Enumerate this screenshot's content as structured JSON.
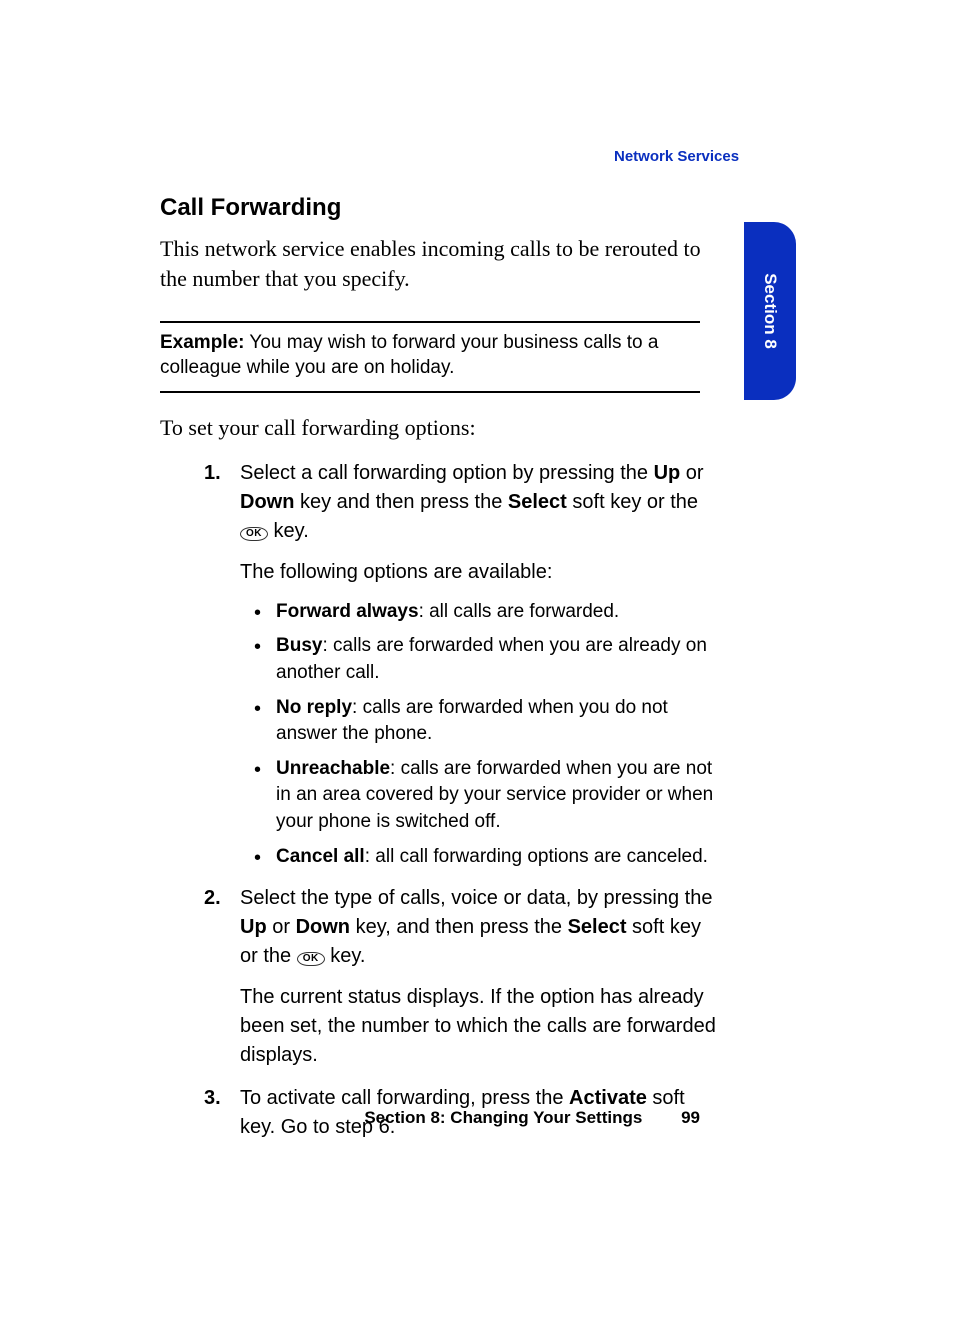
{
  "header": {
    "category": "Network Services"
  },
  "tab": {
    "label": "Section 8"
  },
  "title": "Call Forwarding",
  "intro": "This network service enables incoming calls to be rerouted to the number that you specify.",
  "example": {
    "label": "Example:",
    "text": "You may wish to forward your business calls to a colleague while you are on holiday."
  },
  "lead": "To set your call forwarding options:",
  "ok_label": "OK",
  "step1": {
    "t1": "Select a call forwarding option by pressing the ",
    "up": "Up",
    "t2": " or ",
    "down": "Down",
    "t3": " key and then press the ",
    "select": "Select",
    "t4": " soft key or the ",
    "t5": " key.",
    "avail": "The following options are available:"
  },
  "options": {
    "fa": {
      "name": "Forward always",
      "desc": ": all calls are forwarded."
    },
    "busy": {
      "name": "Busy",
      "desc": ": calls are forwarded when you are already on another call."
    },
    "nr": {
      "name": "No reply",
      "desc": ": calls are forwarded when you do not answer the phone."
    },
    "un": {
      "name": "Unreachable",
      "desc": ": calls are forwarded when you are not in an area covered by your service provider or when your phone is switched off."
    },
    "ca": {
      "name": "Cancel all",
      "desc": ": all call forwarding options are canceled."
    }
  },
  "step2": {
    "t1": "Select the type of calls, voice or data, by pressing the ",
    "up": "Up",
    "t2": " or ",
    "down": "Down",
    "t3": " key, and then press the ",
    "select": "Select",
    "t4": " soft key or the ",
    "t5": " key.",
    "status": "The current status displays. If the option has already been set, the number to which the calls are forwarded displays."
  },
  "step3": {
    "t1": "To activate call forwarding, press the ",
    "activate": "Activate",
    "t2": " soft key. Go to step 6."
  },
  "footer": {
    "section": "Section 8: Changing Your Settings",
    "page": "99"
  }
}
